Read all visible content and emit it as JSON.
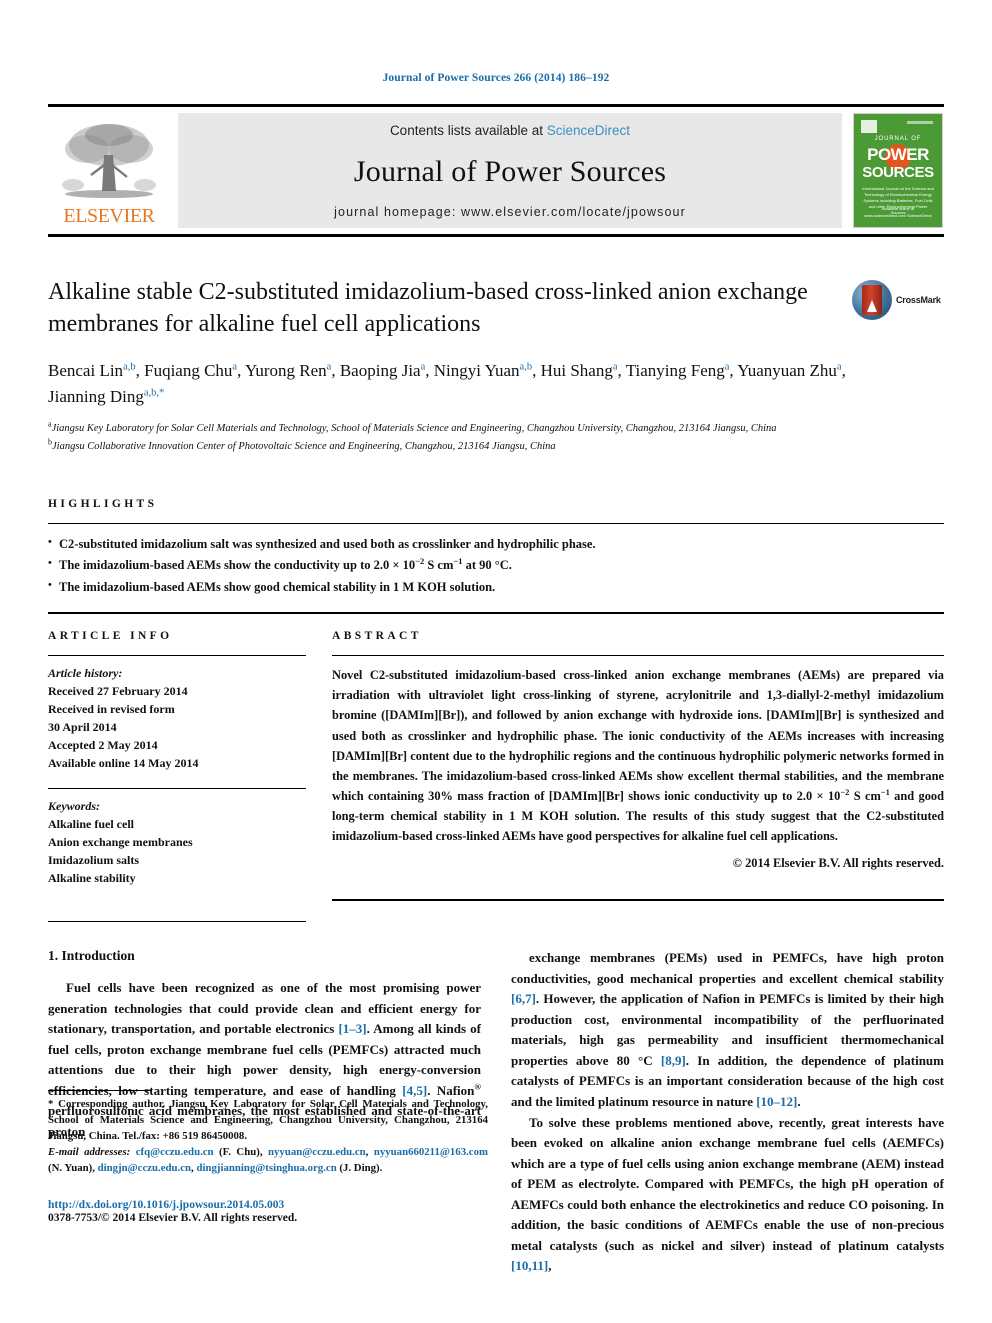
{
  "running_head": "Journal of Power Sources 266 (2014) 186–192",
  "masthead": {
    "elsevier_wordmark": "ELSEVIER",
    "contents_prefix": "Contents lists available at ",
    "sciencedirect": "ScienceDirect",
    "journal_title": "Journal of Power Sources",
    "homepage": "journal homepage: www.elsevier.com/locate/jpowsour",
    "cover": {
      "journal_of": "JOURNAL OF",
      "power": "POWER",
      "sources": "SOURCES",
      "subtitle": "International Journal on the Science and Technology of Electrochemical Energy Systems including Batteries, Fuel Cells and other Electrochemical Power Sources",
      "footer": "Available online at www.sciencedirect.com ScienceDirect"
    },
    "colors": {
      "link": "#3a8fc4",
      "elsevier_orange": "#e87722",
      "cover_green": "#4b9a36",
      "cover_sun": "#e2551f"
    }
  },
  "title": "Alkaline stable C2-substituted imidazolium-based cross-linked anion exchange membranes for alkaline fuel cell applications",
  "crossmark_label": "CrossMark",
  "authors": [
    {
      "name": "Bencai Lin",
      "sup": "a,b",
      "sep": ", "
    },
    {
      "name": "Fuqiang Chu",
      "sup": "a",
      "sep": ", "
    },
    {
      "name": "Yurong Ren",
      "sup": "a",
      "sep": ", "
    },
    {
      "name": "Baoping Jia",
      "sup": "a",
      "sep": ", "
    },
    {
      "name": "Ningyi Yuan",
      "sup": "a,b",
      "sep": ", "
    },
    {
      "name": "Hui Shang",
      "sup": "a",
      "sep": ", "
    },
    {
      "name": "Tianying Feng",
      "sup": "a",
      "sep": ", "
    },
    {
      "name": "Yuanyuan Zhu",
      "sup": "a",
      "sep": ", "
    },
    {
      "name": "Jianning Ding",
      "sup": "a,b,*",
      "sep": ""
    }
  ],
  "affiliations": [
    {
      "mark": "a",
      "text": "Jiangsu Key Laboratory for Solar Cell Materials and Technology, School of Materials Science and Engineering, Changzhou University, Changzhou, 213164 Jiangsu, China"
    },
    {
      "mark": "b",
      "text": "Jiangsu Collaborative Innovation Center of Photovoltaic Science and Engineering, Changzhou, 213164 Jiangsu, China"
    }
  ],
  "highlights": {
    "label": "HIGHLIGHTS",
    "items": [
      "C2-substituted imidazolium salt was synthesized and used both as crosslinker and hydrophilic phase.",
      "The imidazolium-based AEMs show the conductivity up to 2.0 × 10−2 S cm−1 at 90 °C.",
      "The imidazolium-based AEMs show good chemical stability in 1 M KOH solution."
    ],
    "items_html": [
      "C2-substituted imidazolium salt was synthesized and used both as crosslinker and hydrophilic phase.",
      "The imidazolium-based AEMs show the conductivity up to 2.0 &#215; 10<sup class=\"supn\">&#8722;2</sup> S cm<sup class=\"supn\">&#8722;1</sup> at 90 &#176;C.",
      "The imidazolium-based AEMs show good chemical stability in 1 M KOH solution."
    ]
  },
  "article_info": {
    "label": "ARTICLE INFO",
    "history_label": "Article history:",
    "history": [
      "Received 27 February 2014",
      "Received in revised form",
      "30 April 2014",
      "Accepted 2 May 2014",
      "Available online 14 May 2014"
    ],
    "keywords_label": "Keywords:",
    "keywords": [
      "Alkaline fuel cell",
      "Anion exchange membranes",
      "Imidazolium salts",
      "Alkaline stability"
    ]
  },
  "abstract": {
    "label": "ABSTRACT",
    "text": "Novel C2-substituted imidazolium-based cross-linked anion exchange membranes (AEMs) are prepared via irradiation with ultraviolet light cross-linking of styrene, acrylonitrile and 1,3-diallyl-2-methyl imidazolium bromine ([DAMIm][Br]), and followed by anion exchange with hydroxide ions. [DAMIm][Br] is synthesized and used both as crosslinker and hydrophilic phase. The ionic conductivity of the AEMs increases with increasing [DAMIm][Br] content due to the hydrophilic regions and the continuous hydrophilic polymeric networks formed in the membranes. The imidazolium-based cross-linked AEMs show excellent thermal stabilities, and the membrane which containing 30% mass fraction of [DAMIm][Br] shows ionic conductivity up to 2.0 × 10−2 S cm−1 and good long-term chemical stability in 1 M KOH solution. The results of this study suggest that the C2-substituted imidazolium-based cross-linked AEMs have good perspectives for alkaline fuel cell applications.",
    "text_html": "Novel C2-substituted imidazolium-based cross-linked anion exchange membranes (AEMs) are prepared via irradiation with ultraviolet light cross-linking of styrene, acrylonitrile and 1,3-diallyl-2-methyl imidazolium bromine ([DAMIm][Br]), and followed by anion exchange with hydroxide ions. [DAMIm][Br] is synthesized and used both as crosslinker and hydrophilic phase. The ionic conductivity of the AEMs increases with increasing [DAMIm][Br] content due to the hydrophilic regions and the continuous hydrophilic polymeric networks formed in the membranes. The imidazolium-based cross-linked AEMs show excellent thermal stabilities, and the membrane which containing 30% mass fraction of [DAMIm][Br] shows ionic conductivity up to 2.0 &#215; 10<sup class=\"supn\">&#8722;2</sup> S cm<sup class=\"supn\">&#8722;1</sup> and good long-term chemical stability in 1 M KOH solution. The results of this study suggest that the C2-substituted imidazolium-based cross-linked AEMs have good perspectives for alkaline fuel cell applications.",
    "copyright": "© 2014 Elsevier B.V. All rights reserved."
  },
  "body": {
    "section_number_title": "1. Introduction",
    "left_paragraph_html": "Fuel cells have been recognized as one of the most promising power generation technologies that could provide clean and efficient energy for stationary, transportation, and portable electronics <span class=\"ref\">[1&#8211;3]</span>. Among all kinds of fuel cells, proton exchange membrane fuel cells (PEMFCs) attracted much attentions due to their high power density, high energy-conversion efficiencies, low starting temperature, and ease of handling <span class=\"ref\">[4,5]</span>. Nafion<sup class=\"supn\">&#174;</sup> perfluorosulfonic acid membranes, the most established and state-of-the-art proton",
    "right_paragraph_1_html": "exchange membranes (PEMs) used in PEMFCs, have high proton conductivities, good mechanical properties and excellent chemical stability <span class=\"ref\">[6,7]</span>. However, the application of Nafion in PEMFCs is limited by their high production cost, environmental incompatibility of the perfluorinated materials, high gas permeability and insufficient thermomechanical properties above 80 &#176;C <span class=\"ref\">[8,9]</span>. In addition, the dependence of platinum catalysts of PEMFCs is an important consideration because of the high cost and the limited platinum resource in nature <span class=\"ref\">[10&#8211;12]</span>.",
    "right_paragraph_2_html": "To solve these problems mentioned above, recently, great interests have been evoked on alkaline anion exchange membrane fuel cells (AEMFCs) which are a type of fuel cells using anion exchange membrane (AEM) instead of PEM as electrolyte. Compared with PEMFCs, the high pH operation of AEMFCs could both enhance the electrokinetics and reduce CO poisoning. In addition, the basic conditions of AEMFCs enable the use of non-precious metal catalysts (such as nickel and silver) instead of platinum catalysts <span class=\"ref\">[10,11]</span>,"
  },
  "footnote": {
    "corresponding_html": "* Corresponding author. Jiangsu Key Laboratory for Solar Cell Materials and Technology, School of Materials Science and Engineering, Changzhou University, Changzhou, 213164 Jiangsu, China. Tel./fax: +86 519 86450008.",
    "emails_html": "<span class=\"ital\">E-mail addresses:</span> <span class=\"link\">cfq@cczu.edu.cn</span> (F. Chu), <span class=\"link\">nyyuan@cczu.edu.cn</span>, <span class=\"link\">nyyuan660211@163.com</span> (N. Yuan), <span class=\"link\">dingjn@cczu.edu.cn</span>, <span class=\"link\">dingjianning@tsinghua.org.cn</span> (J. Ding).",
    "doi": "http://dx.doi.org/10.1016/j.jpowsour.2014.05.003",
    "issn_html": "0378-7753/&#169; 2014 Elsevier B.V. All rights reserved."
  }
}
